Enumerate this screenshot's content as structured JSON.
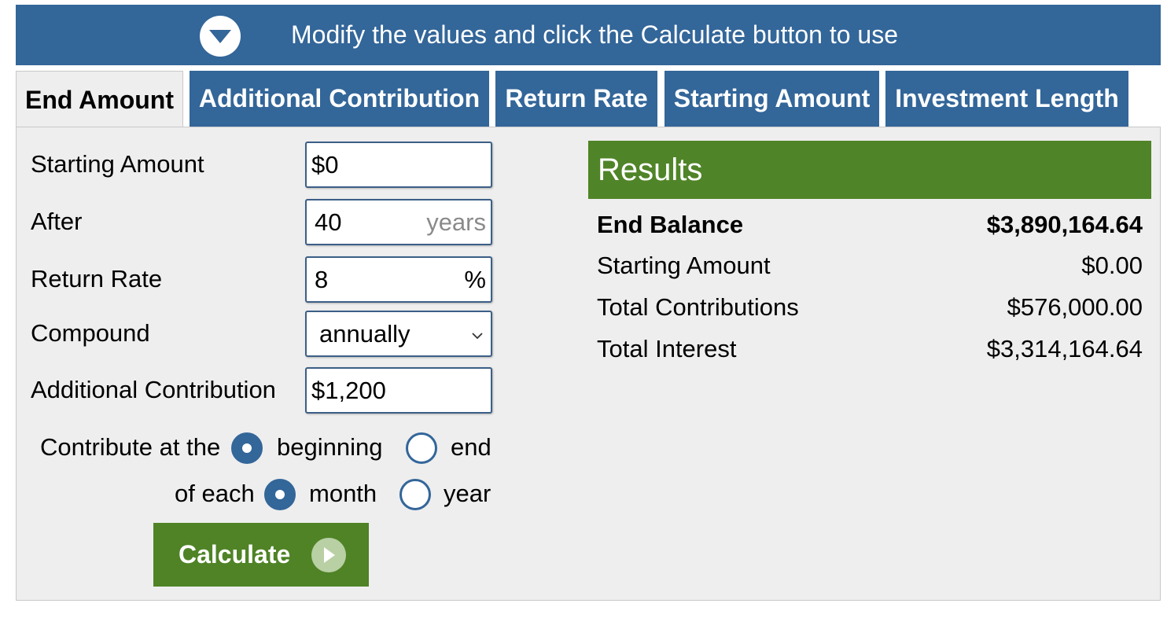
{
  "banner": {
    "text": "Modify the values and click the Calculate button to use",
    "icon": "chevron-down-circle-icon"
  },
  "tabs": [
    {
      "label": "End Amount",
      "active": true
    },
    {
      "label": "Additional Contribution",
      "active": false
    },
    {
      "label": "Return Rate",
      "active": false
    },
    {
      "label": "Starting Amount",
      "active": false
    },
    {
      "label": "Investment Length",
      "active": false
    }
  ],
  "form": {
    "starting_amount": {
      "label": "Starting Amount",
      "value": "$0"
    },
    "after": {
      "label": "After",
      "value": "40",
      "unit": "years"
    },
    "return_rate": {
      "label": "Return Rate",
      "value": "8",
      "unit": "%"
    },
    "compound": {
      "label": "Compound",
      "value": "annually"
    },
    "additional_contribution": {
      "label": "Additional Contribution",
      "value": "$1,200"
    },
    "contribute_at": {
      "label": "Contribute at the",
      "option_beginning": "beginning",
      "option_end": "end",
      "selected": "beginning"
    },
    "of_each": {
      "label": "of each",
      "option_month": "month",
      "option_year": "year",
      "selected": "month"
    },
    "calculate_label": "Calculate"
  },
  "results": {
    "title": "Results",
    "rows": [
      {
        "label": "End Balance",
        "value": "$3,890,164.64"
      },
      {
        "label": "Starting Amount",
        "value": "$0.00"
      },
      {
        "label": "Total Contributions",
        "value": "$576,000.00"
      },
      {
        "label": "Total Interest",
        "value": "$3,314,164.64"
      }
    ]
  },
  "colors": {
    "header_blue": "#336699",
    "results_green": "#508428",
    "button_green": "#4f8326",
    "panel_gray": "#eeeeee"
  }
}
